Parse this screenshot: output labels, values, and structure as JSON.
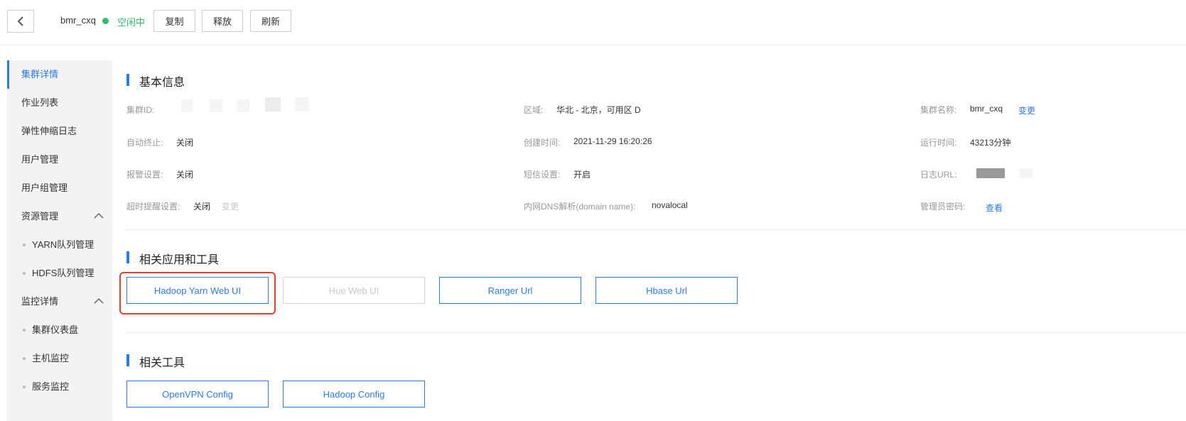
{
  "header": {
    "cluster_name": "bmr_cxq",
    "status": "空闲中",
    "status_color": "#2ebd6b",
    "buttons": {
      "copy": "复制",
      "release": "释放",
      "refresh": "刷新"
    }
  },
  "sidebar": {
    "items": [
      {
        "label": "集群详情",
        "active": true
      },
      {
        "label": "作业列表"
      },
      {
        "label": "弹性伸缩日志"
      },
      {
        "label": "用户管理"
      },
      {
        "label": "用户组管理"
      },
      {
        "label": "资源管理",
        "expanded": true
      },
      {
        "label": "YARN队列管理",
        "sub": true
      },
      {
        "label": "HDFS队列管理",
        "sub": true
      },
      {
        "label": "监控详情",
        "expanded": true
      },
      {
        "label": "集群仪表盘",
        "sub": true
      },
      {
        "label": "主机监控",
        "sub": true
      },
      {
        "label": "服务监控",
        "sub": true
      }
    ]
  },
  "basic_info": {
    "title": "基本信息",
    "cluster_id_label": "集群ID:",
    "region_label": "区域:",
    "region_value": "华北 - 北京，可用区 D",
    "cluster_name_label": "集群名称:",
    "cluster_name_value": "bmr_cxq",
    "cluster_name_action": "变更",
    "auto_stop_label": "自动终止:",
    "auto_stop_value": "关闭",
    "created_label": "创建时间:",
    "created_value": "2021-11-29 16:20:26",
    "runtime_label": "运行时间:",
    "runtime_value": "43213分钟",
    "alarm_label": "报警设置:",
    "alarm_value": "关闭",
    "sms_label": "短信设置:",
    "sms_value": "开启",
    "log_url_label": "日志URL:",
    "timeout_label": "超时提醒设置:",
    "timeout_value": "关闭",
    "timeout_action": "变更",
    "dns_label": "内网DNS解析(domain name):",
    "dns_value": "novalocal",
    "admin_pwd_label": "管理员密码:",
    "admin_pwd_action": "查看"
  },
  "related_apps": {
    "title": "相关应用和工具",
    "buttons": [
      {
        "label": "Hadoop Yarn Web UI",
        "enabled": true
      },
      {
        "label": "Hue Web UI",
        "enabled": false
      },
      {
        "label": "Ranger Url",
        "enabled": true
      },
      {
        "label": "Hbase Url",
        "enabled": true
      }
    ]
  },
  "related_tools": {
    "title": "相关工具",
    "buttons": [
      {
        "label": "OpenVPN Config"
      },
      {
        "label": "Hadoop Config"
      }
    ]
  },
  "colors": {
    "accent": "#2d7be5",
    "highlight": "#e0402d"
  }
}
